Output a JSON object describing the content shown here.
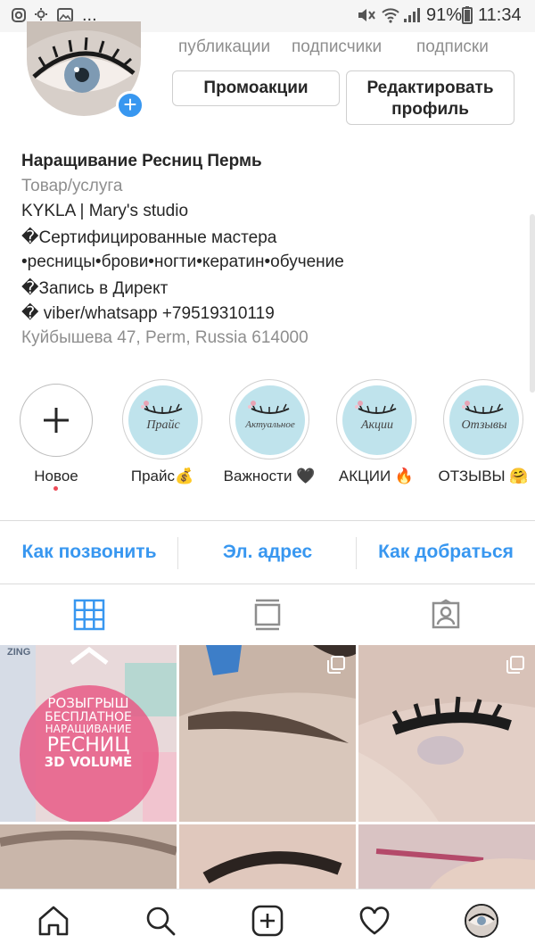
{
  "status_bar": {
    "dots": "...",
    "battery": "91%",
    "time": "11:34"
  },
  "header": {
    "stats": [
      "публикации",
      "подписчики",
      "подписки"
    ],
    "promo_button": "Промоакции",
    "edit_button_line1": "Редактировать",
    "edit_button_line2": "профиль"
  },
  "bio": {
    "name": "Наращивание Ресниц Пермь",
    "category": "Товар/услуга",
    "line1": "KYKLA | Mary's studio",
    "line2": "�Сертифицированные мастера",
    "line3": "•ресницы•брови•ногти•кератин•обучение",
    "line4": "�Запись в Директ",
    "line5": "� viber/whatsapp +79519310119",
    "address": "Куйбышева 47, Perm, Russia 614000"
  },
  "highlights": [
    {
      "label": "Новое",
      "cover": ""
    },
    {
      "label": "Прайс💰",
      "cover": "Прайс"
    },
    {
      "label": "Важности 🖤",
      "cover": "Актуальное"
    },
    {
      "label": "АКЦИИ 🔥",
      "cover": "Акции"
    },
    {
      "label": "ОТЗЫВЫ 🤗",
      "cover": "Отзывы"
    }
  ],
  "contact": {
    "call": "Как позвонить",
    "email": "Эл. адрес",
    "directions": "Как добраться"
  },
  "post1": {
    "brand": "ZING",
    "l1": "РОЗЫГРЫШ",
    "l2": "БЕСПЛАТНОЕ",
    "l3": "НАРАЩИВАНИЕ",
    "l4": "РЕСНИЦ",
    "l5": "3D VOLUME"
  },
  "colors": {
    "accent": "#3897f0",
    "text": "#262626",
    "muted": "#8e8e8e",
    "highlight_bg": "#bfe3ec",
    "promo_pink": "#e85a86"
  }
}
